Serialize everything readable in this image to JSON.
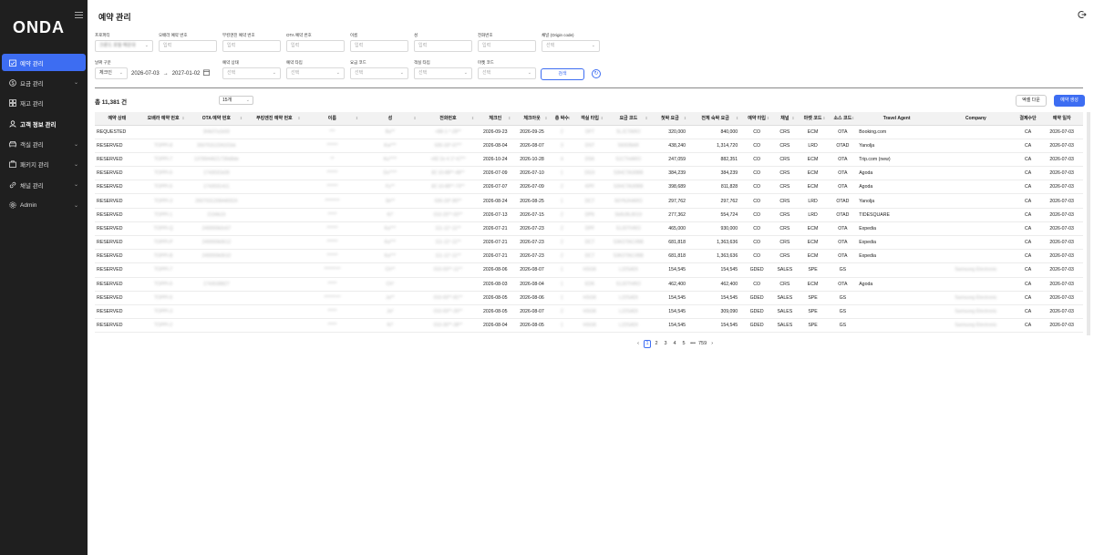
{
  "brand": "ONDA",
  "page_title": "예약 관리",
  "sidebar": {
    "items": [
      {
        "label": "예약 관리",
        "icon": "calendar-check-icon",
        "active": true,
        "chevron": false
      },
      {
        "label": "요금 관리",
        "icon": "dollar-icon",
        "active": false,
        "chevron": true
      },
      {
        "label": "재고 관리",
        "icon": "grid-icon",
        "active": false,
        "chevron": false
      },
      {
        "label": "고객 정보 관리",
        "icon": "user-icon",
        "active": false,
        "chevron": false,
        "bold": true
      },
      {
        "label": "객실 관리",
        "icon": "bed-icon",
        "active": false,
        "chevron": true
      },
      {
        "label": "패키지 관리",
        "icon": "package-icon",
        "active": false,
        "chevron": true
      },
      {
        "label": "채널 관리",
        "icon": "link-icon",
        "active": false,
        "chevron": true
      },
      {
        "label": "Admin",
        "icon": "gear-icon",
        "active": false,
        "chevron": true
      }
    ]
  },
  "filters": {
    "row1": [
      {
        "label": "프로퍼티",
        "value": "크룬드 호텔 해운대",
        "dropdown": true
      },
      {
        "label": "오배라 예약 번호",
        "placeholder": "입력"
      },
      {
        "label": "부킹엔진 예약 번호",
        "placeholder": "입력"
      },
      {
        "label": "OTA 예약 번호",
        "placeholder": "입력"
      },
      {
        "label": "이름",
        "placeholder": "입력"
      },
      {
        "label": "성",
        "placeholder": "입력"
      },
      {
        "label": "전화번호",
        "placeholder": "입력"
      },
      {
        "label": "채널 (Origin code)",
        "placeholder": "선택",
        "dropdown": true
      }
    ],
    "row2": {
      "date_type": {
        "label": "날짜 구분",
        "value": "체크인"
      },
      "date_from": "2026-07-03",
      "date_sep": "→",
      "date_to": "2027-01-02",
      "selects": [
        {
          "label": "예약 상태",
          "placeholder": "선택"
        },
        {
          "label": "예약 타입",
          "placeholder": "선택"
        },
        {
          "label": "요금 코드",
          "placeholder": "선택"
        },
        {
          "label": "객실 타입",
          "placeholder": "선택"
        },
        {
          "label": "마켓 코드",
          "placeholder": "선택"
        }
      ],
      "search_label": "검색"
    }
  },
  "summary": {
    "total": "총 11,381 건",
    "page_size": "15개"
  },
  "actions": {
    "excel": "엑셀 다운",
    "create": "예약 생성"
  },
  "table": {
    "columns": [
      "예약 상태",
      "오배라 예약 번호",
      "OTA 예약 번호",
      "부킹엔진 예약 번호",
      "이름",
      "성",
      "전화번호",
      "체크인",
      "체크아웃",
      "총 박수",
      "객실 타입",
      "요금 코드",
      "첫박 요금",
      "전체 숙박 요금",
      "예약 타입",
      "채널",
      "마켓 코드",
      "소스 코드",
      "Travel Agent",
      "Company",
      "결제수단",
      "예약 일자"
    ],
    "rows": [
      [
        "REQUESTED",
        "",
        "3Hk07a1k93",
        "",
        "***",
        "Ba**",
        "+88-1-*-28**",
        "2026-09-23",
        "2026-09-25",
        "2",
        "DFT",
        "5LJCTARO",
        "320,000",
        "840,000",
        "CO",
        "CRS",
        "ECM",
        "OTA",
        "Booking.com",
        "",
        "CA",
        "2026-07-03"
      ],
      [
        "RESERVED",
        "TOPPI-8",
        "2607031234101kk",
        "",
        "******",
        "Kw***",
        "030-33*-07**",
        "2026-08-04",
        "2026-08-07",
        "3",
        "DST",
        "560DBAR",
        "438,240",
        "1,314,720",
        "CO",
        "CRS",
        "LRD",
        "OTAD",
        "Yanolja",
        "",
        "CA",
        "2026-07-03"
      ],
      [
        "RESERVED",
        "TOPPI-7",
        "1378944621739d8de",
        "",
        "**",
        "Ku****",
        "+82 2e 4 1*-67**",
        "2026-10-24",
        "2026-10-28",
        "4",
        "DSK",
        "51CTHARO",
        "247,059",
        "882,351",
        "CO",
        "CRS",
        "ECM",
        "OTA",
        "Trip.com (new)",
        "",
        "CA",
        "2026-07-03"
      ],
      [
        "RESERVED",
        "TOPPI-6",
        "1743031k09",
        "",
        "******",
        "Do****",
        "82 10-88**-48**",
        "2026-07-09",
        "2026-07-10",
        "1",
        "DGX",
        "53HCTA30BB",
        "384,239",
        "384,239",
        "CO",
        "CRS",
        "ECM",
        "OTA",
        "Agoda",
        "",
        "CA",
        "2026-07-03"
      ],
      [
        "RESERVED",
        "TOPPI-5",
        "1743031411",
        "",
        "******",
        "Fy**",
        "82 10-88**-73**",
        "2026-07-07",
        "2026-07-09",
        "2",
        "KPF",
        "53HCTA30BB",
        "398,689",
        "811,828",
        "CO",
        "CRS",
        "ECM",
        "OTA",
        "Agoda",
        "",
        "CA",
        "2026-07-03"
      ],
      [
        "RESERVED",
        "TOPPI-3",
        "2607031208440024",
        "",
        "********",
        "Sh**",
        "030-33*-80**",
        "2026-08-24",
        "2026-08-25",
        "1",
        "DCT",
        "56YNJHARO",
        "297,762",
        "297,762",
        "CO",
        "CRS",
        "LRD",
        "OTAD",
        "Yanolja",
        "",
        "CA",
        "2026-07-03"
      ],
      [
        "RESERVED",
        "TOPPI-1",
        "2194k19",
        "",
        "*****",
        "Ki*",
        "010-25**-50**",
        "2026-07-13",
        "2026-07-15",
        "2",
        "DPK",
        "5k8U8L8019",
        "277,362",
        "554,724",
        "CO",
        "CRS",
        "LRD",
        "OTAD",
        "TIDESQUARE",
        "",
        "CA",
        "2026-07-03"
      ],
      [
        "RESERVED",
        "TOPPI-Q",
        "249990k0n67",
        "",
        "******",
        "Ka***",
        "111-11*-11**",
        "2026-07-21",
        "2026-07-23",
        "2",
        "DPF",
        "51JDTHRO",
        "465,000",
        "930,000",
        "CO",
        "CRS",
        "ECM",
        "OTA",
        "Expedia",
        "",
        "CA",
        "2026-07-03"
      ],
      [
        "RESERVED",
        "TOPPI-P",
        "249990k0612",
        "",
        "******",
        "Ka***",
        "111-11*-11**",
        "2026-07-21",
        "2026-07-23",
        "2",
        "DCT",
        "53KOTAC#BB",
        "681,818",
        "1,363,636",
        "CO",
        "CRS",
        "ECM",
        "OTA",
        "Expedia",
        "",
        "CA",
        "2026-07-03"
      ],
      [
        "RESERVED",
        "TOPPI-B",
        "249990k0610",
        "",
        "******",
        "Ka***",
        "111-11*-11**",
        "2026-07-21",
        "2026-07-23",
        "2",
        "DCT",
        "53KOTAC#BB",
        "681,818",
        "1,363,636",
        "CO",
        "CRS",
        "ECM",
        "OTA",
        "Expedia",
        "",
        "CA",
        "2026-07-03"
      ],
      [
        "RESERVED",
        "TOPPI-7",
        "",
        "",
        "*********",
        "Ch**",
        "010-93**-11**",
        "2026-08-06",
        "2026-08-07",
        "1",
        "HSGK",
        "L22SADt",
        "154,545",
        "154,545",
        "GDED",
        "SALES",
        "SPE",
        "GS",
        "",
        "Samsung Electronic",
        "CA",
        "2026-07-03"
      ],
      [
        "RESERVED",
        "TOPPI-6",
        "1743038827",
        "",
        "*****",
        "Ch*",
        "",
        "2026-08-03",
        "2026-08-04",
        "1",
        "EDK",
        "51JDTHRO",
        "462,400",
        "462,400",
        "CO",
        "CRS",
        "ECM",
        "OTA",
        "Agoda",
        "",
        "CA",
        "2026-07-03"
      ],
      [
        "RESERVED",
        "TOPPI-5",
        "",
        "",
        "*********",
        "Ja**",
        "010-93**-81**",
        "2026-08-05",
        "2026-08-06",
        "1",
        "HSGK",
        "L22SADt",
        "154,545",
        "154,545",
        "GDED",
        "SALES",
        "SPE",
        "GS",
        "",
        "Samsung Electronic",
        "CA",
        "2026-07-03"
      ],
      [
        "RESERVED",
        "TOPPI-3",
        "",
        "",
        "*****",
        "Ja*",
        "010-93**-30**",
        "2026-08-05",
        "2026-08-07",
        "2",
        "HSGK",
        "L22SADt",
        "154,545",
        "309,090",
        "GDED",
        "SALES",
        "SPE",
        "GS",
        "",
        "Samsung Electronic",
        "CA",
        "2026-07-03"
      ],
      [
        "RESERVED",
        "TOPPI-2",
        "",
        "",
        "*****",
        "Ki*",
        "010-30**-38**",
        "2026-08-04",
        "2026-08-05",
        "1",
        "HSGK",
        "L22SADt",
        "154,545",
        "154,545",
        "GDED",
        "SALES",
        "SPE",
        "GS",
        "",
        "Samsung Electronic",
        "CA",
        "2026-07-03"
      ]
    ]
  },
  "pagination": {
    "prev": "‹",
    "pages": [
      "1",
      "2",
      "3",
      "4",
      "5"
    ],
    "ellipsis": "•••",
    "last": "759",
    "next": "›",
    "current": "1"
  }
}
